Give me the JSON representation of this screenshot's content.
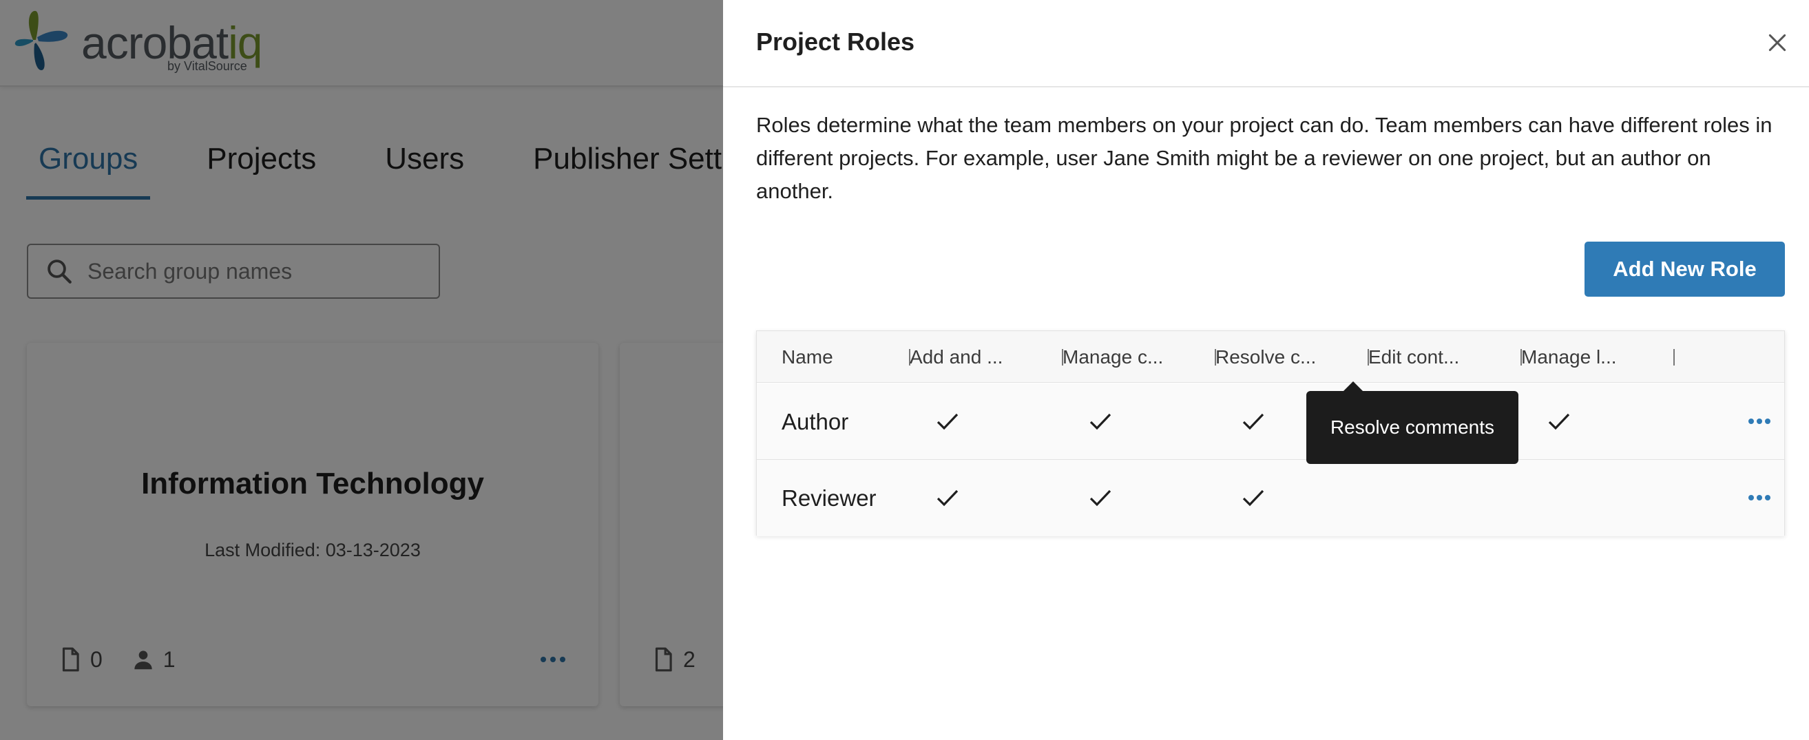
{
  "logo": {
    "name_prefix": "acrobat",
    "name_suffix": "iq",
    "byline": "by VitalSource"
  },
  "nav": {
    "tabs": [
      {
        "label": "Groups",
        "active": true
      },
      {
        "label": "Projects",
        "active": false
      },
      {
        "label": "Users",
        "active": false
      },
      {
        "label": "Publisher Settings",
        "active": false
      }
    ]
  },
  "search": {
    "placeholder": "Search group names",
    "value": ""
  },
  "cards": [
    {
      "title": "Information Technology",
      "modified": "Last Modified: 03-13-2023",
      "projects": "0",
      "users": "1"
    },
    {
      "title": "",
      "modified": "",
      "projects": "2",
      "users": ""
    }
  ],
  "drawer": {
    "title": "Project Roles",
    "description": "Roles determine what the team members on your project can do. Team members can have different roles in different projects. For example, user Jane Smith might be a reviewer on one project, but an author on another.",
    "add_button": "Add New Role",
    "table": {
      "columns": [
        "Name",
        "Add and ...",
        "Manage c...",
        "Resolve c...",
        "Edit cont...",
        "Manage l..."
      ],
      "rows": [
        {
          "name": "Author",
          "permissions": [
            true,
            true,
            true,
            true,
            true
          ]
        },
        {
          "name": "Reviewer",
          "permissions": [
            true,
            true,
            true,
            false,
            false
          ]
        }
      ]
    },
    "tooltip": "Resolve comments"
  },
  "colors": {
    "accent": "#2f7bb6",
    "tab_active": "#2f74a8",
    "logo_green": "#7a9a2e",
    "tooltip_bg": "#1c1c1c"
  },
  "icons": [
    "search-icon",
    "document-icon",
    "person-icon",
    "more-horizontal-icon",
    "close-icon",
    "check-icon"
  ]
}
